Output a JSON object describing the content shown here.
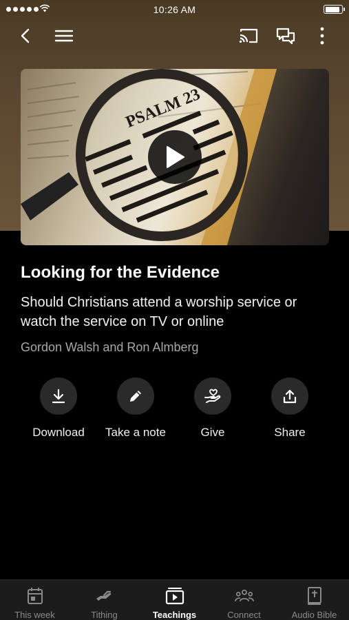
{
  "status": {
    "time": "10:26 AM",
    "battery_level": 0.9
  },
  "nav": {
    "back_icon": "chevron-left-icon",
    "menu_icon": "hamburger-menu-icon",
    "cast_icon": "cast-icon",
    "chat_icon": "chat-bubbles-icon",
    "more_icon": "more-vertical-icon"
  },
  "hero": {
    "book_heading": "PSALM 23"
  },
  "teaching": {
    "title": "Looking for the Evidence",
    "subtitle": "Should Christians attend a worship service or watch the service on TV or online",
    "authors": "Gordon Walsh and Ron Almberg"
  },
  "actions": [
    {
      "label": "Download",
      "icon": "download-icon"
    },
    {
      "label": "Take a note",
      "icon": "pencil-icon"
    },
    {
      "label": "Give",
      "icon": "heart-hand-icon"
    },
    {
      "label": "Share",
      "icon": "share-icon"
    }
  ],
  "tabs": [
    {
      "label": "This week",
      "icon": "calendar-icon",
      "active": false
    },
    {
      "label": "Tithing",
      "icon": "tithing-hand-icon",
      "active": false
    },
    {
      "label": "Teachings",
      "icon": "video-play-icon",
      "active": true
    },
    {
      "label": "Connect",
      "icon": "people-group-icon",
      "active": false
    },
    {
      "label": "Audio Bible",
      "icon": "bible-book-icon",
      "active": false
    }
  ],
  "colors": {
    "background": "#000000",
    "header": "#5a4630",
    "tabbar": "#1c1c1c",
    "action_circle": "#2a2a2a"
  }
}
